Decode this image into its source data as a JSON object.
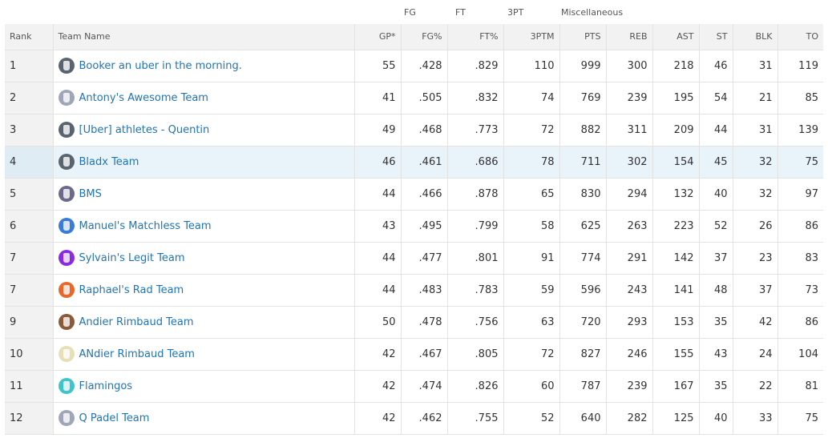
{
  "group_headers": [
    "FG",
    "FT",
    "3PT",
    "Miscellaneous"
  ],
  "columns": [
    "Rank",
    "Team Name",
    "GP*",
    "FG%",
    "FT%",
    "3PTM",
    "PTS",
    "REB",
    "AST",
    "ST",
    "BLK",
    "TO"
  ],
  "rows": [
    {
      "rank": "1",
      "team": "Booker an uber in the morning.",
      "icon": "jersey-dark-icon",
      "avatar_color": "#5a6470",
      "gp": "55",
      "fg": ".428",
      "ft": ".829",
      "tpm": "110",
      "pts": "999",
      "reb": "300",
      "ast": "218",
      "st": "46",
      "blk": "31",
      "to": "119"
    },
    {
      "rank": "2",
      "team": "Antony's Awesome Team",
      "icon": "jersey-gray-icon",
      "avatar_color": "#9ea6b8",
      "gp": "41",
      "fg": ".505",
      "ft": ".832",
      "tpm": "74",
      "pts": "769",
      "reb": "239",
      "ast": "195",
      "st": "54",
      "blk": "21",
      "to": "85"
    },
    {
      "rank": "3",
      "team": "[Uber] athletes - Quentin",
      "icon": "jersey-dark-icon",
      "avatar_color": "#5a6470",
      "gp": "49",
      "fg": ".468",
      "ft": ".773",
      "tpm": "72",
      "pts": "882",
      "reb": "311",
      "ast": "209",
      "st": "44",
      "blk": "31",
      "to": "139"
    },
    {
      "rank": "4",
      "team": "Bladx Team",
      "icon": "jersey-dark-icon",
      "avatar_color": "#5a6470",
      "gp": "46",
      "fg": ".461",
      "ft": ".686",
      "tpm": "78",
      "pts": "711",
      "reb": "302",
      "ast": "154",
      "st": "45",
      "blk": "32",
      "to": "75",
      "highlight": true
    },
    {
      "rank": "5",
      "team": "BMS",
      "icon": "photo-avatar-icon",
      "avatar_color": "#6c6a8a",
      "gp": "44",
      "fg": ".466",
      "ft": ".878",
      "tpm": "65",
      "pts": "830",
      "reb": "294",
      "ast": "132",
      "st": "40",
      "blk": "32",
      "to": "97"
    },
    {
      "rank": "6",
      "team": "Manuel's Matchless Team",
      "icon": "jersey-blue-icon",
      "avatar_color": "#3a7bd5",
      "gp": "43",
      "fg": ".495",
      "ft": ".799",
      "tpm": "58",
      "pts": "625",
      "reb": "263",
      "ast": "223",
      "st": "52",
      "blk": "26",
      "to": "86"
    },
    {
      "rank": "7",
      "team": "Sylvain's Legit Team",
      "icon": "jersey-purple-icon",
      "avatar_color": "#8a2be2",
      "gp": "44",
      "fg": ".477",
      "ft": ".801",
      "tpm": "91",
      "pts": "774",
      "reb": "291",
      "ast": "142",
      "st": "37",
      "blk": "23",
      "to": "83"
    },
    {
      "rank": "7",
      "team": "Raphael's Rad Team",
      "icon": "jersey-orange-icon",
      "avatar_color": "#e8672b",
      "gp": "44",
      "fg": ".483",
      "ft": ".783",
      "tpm": "59",
      "pts": "596",
      "reb": "243",
      "ast": "141",
      "st": "48",
      "blk": "37",
      "to": "73"
    },
    {
      "rank": "9",
      "team": "Andier Rimbaud Team",
      "icon": "photo-avatar-icon",
      "avatar_color": "#8a5a3a",
      "gp": "50",
      "fg": ".478",
      "ft": ".756",
      "tpm": "63",
      "pts": "720",
      "reb": "293",
      "ast": "153",
      "st": "35",
      "blk": "42",
      "to": "86"
    },
    {
      "rank": "10",
      "team": "ANdier Rimbaud Team",
      "icon": "jersey-yellow-icon",
      "avatar_color": "#e6dfb8",
      "gp": "42",
      "fg": ".467",
      "ft": ".805",
      "tpm": "72",
      "pts": "827",
      "reb": "246",
      "ast": "155",
      "st": "43",
      "blk": "24",
      "to": "104"
    },
    {
      "rank": "11",
      "team": "Flamingos",
      "icon": "jersey-pink-icon",
      "avatar_color": "#40c4c9",
      "gp": "42",
      "fg": ".474",
      "ft": ".826",
      "tpm": "60",
      "pts": "787",
      "reb": "239",
      "ast": "167",
      "st": "35",
      "blk": "22",
      "to": "81"
    },
    {
      "rank": "12",
      "team": "Q Padel Team",
      "icon": "jersey-gray-icon",
      "avatar_color": "#9ea6b8",
      "gp": "42",
      "fg": ".462",
      "ft": ".755",
      "tpm": "52",
      "pts": "640",
      "reb": "282",
      "ast": "125",
      "st": "40",
      "blk": "33",
      "to": "75"
    }
  ]
}
